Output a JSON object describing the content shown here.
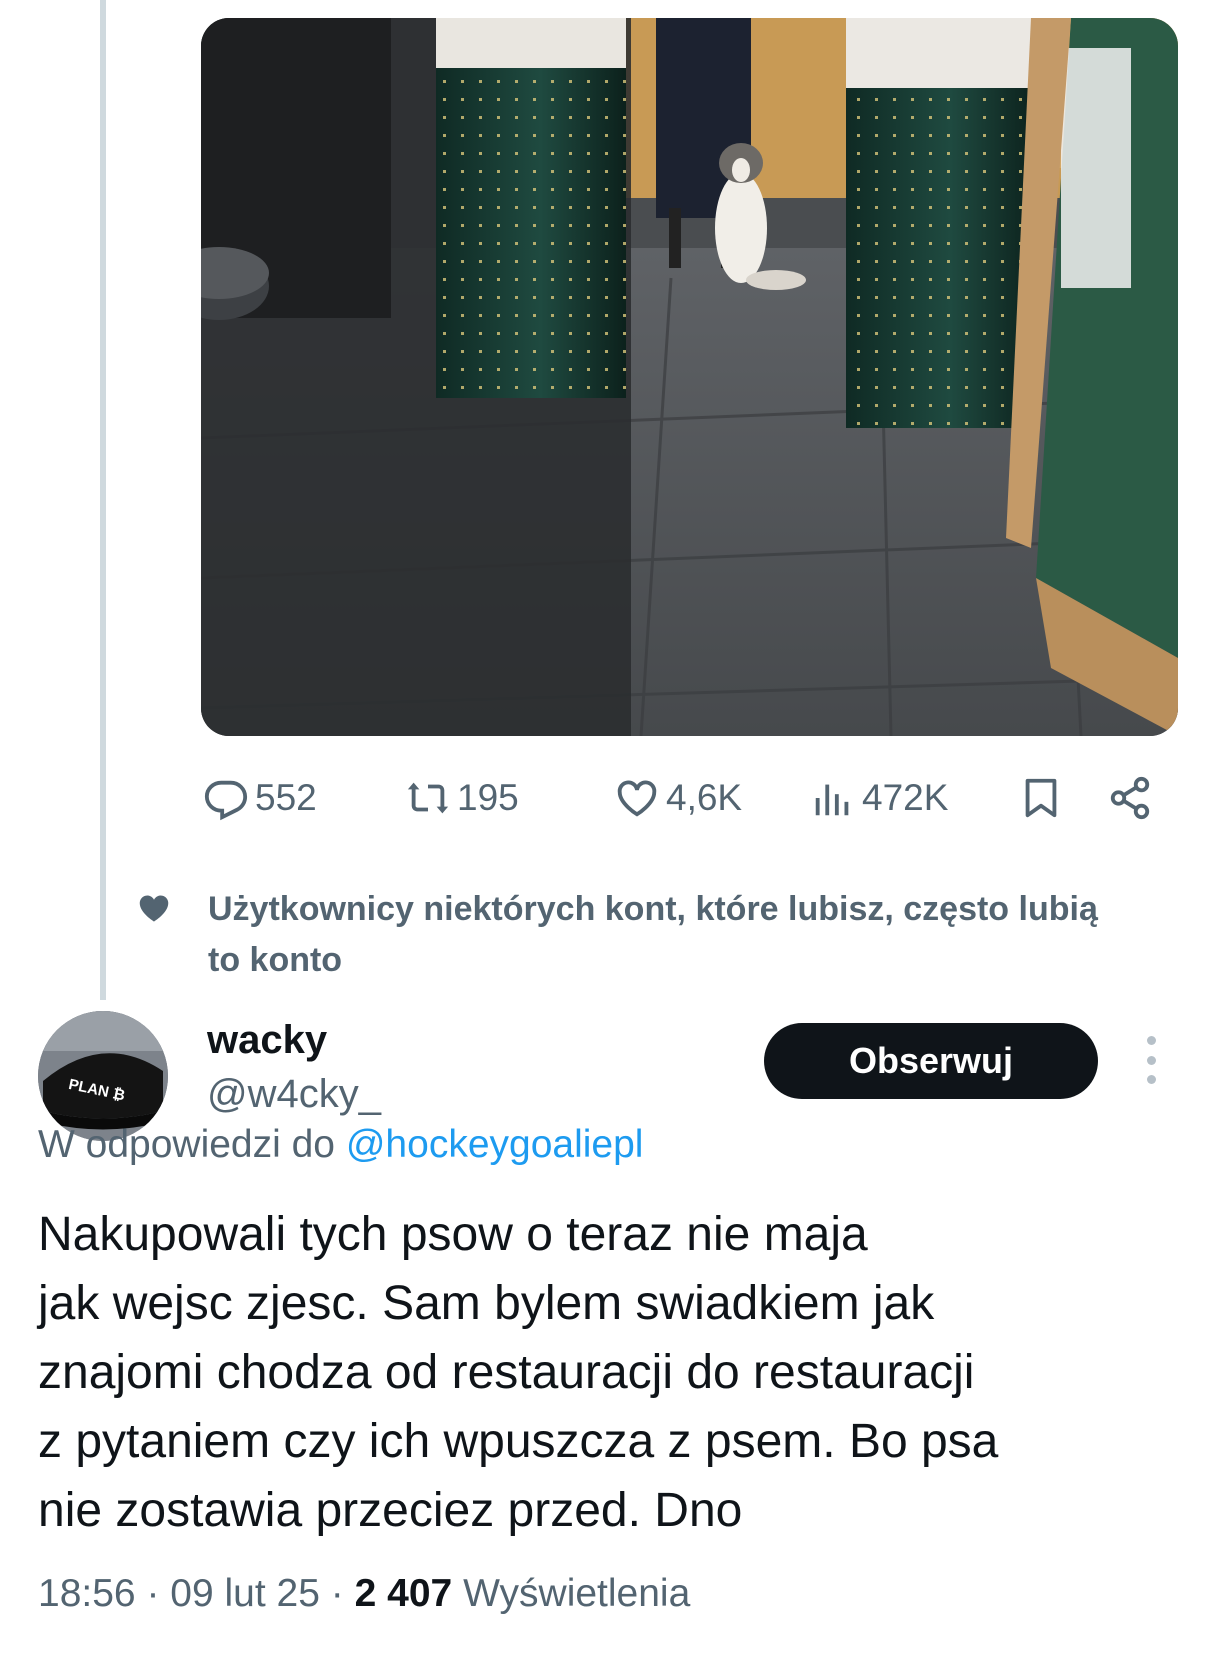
{
  "previous_tweet": {
    "image_alt": "Dog sitting on the floor of a restaurant between two dark green mosaic pillars",
    "actions": {
      "replies": "552",
      "retweets": "195",
      "likes": "4,6K",
      "views": "472K"
    }
  },
  "social_context": {
    "text": "Użytkownicy niektórych kont, które lubisz, często lubią to konto"
  },
  "tweet": {
    "author": {
      "display_name": "wacky",
      "handle": "@w4cky_",
      "avatar_text": "PLAN ₿"
    },
    "follow_label": "Obserwuj",
    "reply_prefix": "W odpowiedzi do",
    "reply_to_handle": "@hockeygoaliepl",
    "text_lines": [
      "Nakupowali tych psow o teraz nie maja",
      "jak wejsc zjesc. Sam bylem swiadkiem jak",
      "znajomi chodza od restauracji do restauracji",
      "z pytaniem czy ich wpuszcza z psem. Bo psa",
      "nie zostawia przeciez przed. Dno"
    ],
    "time": "18:56",
    "date": "09 lut 25",
    "separator": "·",
    "views_count": "2 407",
    "views_label": "Wyświetlenia"
  },
  "icons": {
    "reply": "reply-icon",
    "retweet": "retweet-icon",
    "like": "heart-icon",
    "views": "views-icon",
    "bookmark": "bookmark-icon",
    "share": "share-icon",
    "more": "more-icon"
  },
  "colors": {
    "text_primary": "#0f1419",
    "text_secondary": "#536471",
    "link": "#1d9bf0",
    "follow_button_bg": "#0f1419",
    "thread_line": "#cfd9de"
  }
}
